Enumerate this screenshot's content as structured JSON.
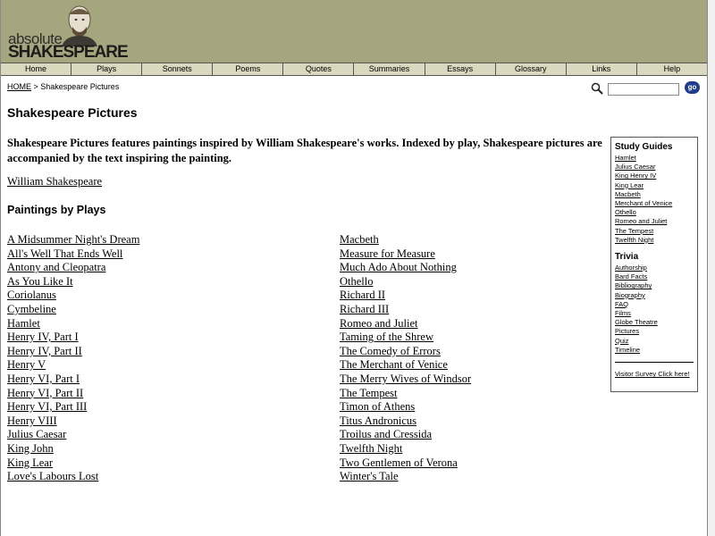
{
  "header": {
    "logo_line1": "absolute",
    "logo_line2": "SHAKESPEARE"
  },
  "nav": [
    "Home",
    "Plays",
    "Sonnets",
    "Poems",
    "Quotes",
    "Summaries",
    "Essays",
    "Glossary",
    "Links",
    "Help"
  ],
  "breadcrumb": {
    "home": "HOME",
    "separator": " > ",
    "current": "Shakespeare Pictures"
  },
  "search": {
    "placeholder": "",
    "button": "go"
  },
  "main": {
    "title": "Shakespeare Pictures",
    "intro": "Shakespeare Pictures features paintings inspired by William Shakespeare's works. Indexed by play, Shakespeare pictures are accompanied by the text inspiring the painting.",
    "author_link": "William Shakespeare",
    "paintings_heading": "Paintings by Plays",
    "plays_left": [
      "A Midsummer Night's Dream",
      "All's Well That Ends Well",
      "Antony and Cleopatra",
      "As You Like It",
      "Coriolanus",
      "Cymbeline",
      "Hamlet",
      "Henry IV, Part I",
      "Henry IV, Part II",
      "Henry V",
      "Henry VI, Part I",
      "Henry VI, Part II",
      "Henry VI, Part III",
      "Henry VIII",
      "Julius Caesar",
      "King John",
      "King Lear",
      "Love's Labours Lost"
    ],
    "plays_right": [
      "Macbeth",
      "Measure for Measure",
      "Much Ado About Nothing",
      "Othello",
      "Richard II",
      "Richard III",
      "Romeo and Juliet",
      "Taming of the Shrew",
      "The Comedy of Errors",
      "The Merchant of Venice",
      "The Merry Wives of Windsor",
      "The Tempest",
      "Timon of Athens",
      "Titus Andronicus",
      "Troilus and Cressida",
      "Twelfth Night",
      "Two Gentlemen of Verona",
      "Winter's Tale"
    ]
  },
  "sidebar": {
    "study_title": "Study Guides",
    "study_links": [
      "Hamlet",
      "Julius Caesar",
      "King Henry IV",
      "King Lear",
      "Macbeth",
      "Merchant of Venice",
      "Othello",
      "Romeo and Juliet",
      "The Tempest",
      "Twelfth Night"
    ],
    "trivia_title": "Trivia",
    "trivia_links": [
      "Authorship",
      "Bard Facts",
      "Bibliography",
      "Biography",
      "FAQ",
      "Films",
      "Globe Theatre",
      "Pictures",
      "Quiz",
      "Timeline"
    ],
    "survey_link": "Visitor Survey Click here!"
  },
  "icons": {
    "search": "magnifier-icon",
    "logo": "shakespeare-bust-icon"
  },
  "colors": {
    "header_bg": "#a6a67e",
    "nav_bg": "#d9d9bf",
    "go_button": "#1d3d8f"
  }
}
